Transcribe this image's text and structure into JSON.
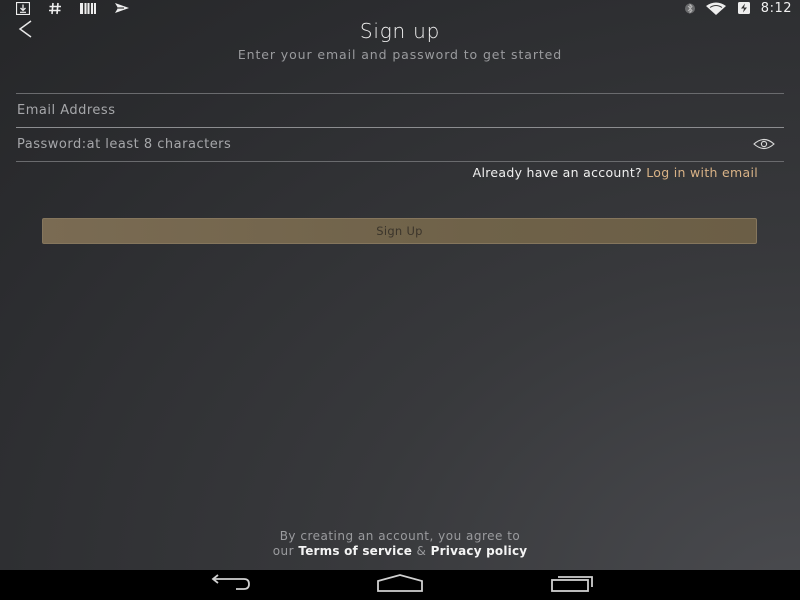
{
  "status_bar": {
    "time": "8:12",
    "left_icons": [
      "download-notification-icon",
      "hash-notification-icon",
      "barcode-notification-icon",
      "send-notification-icon"
    ],
    "right_icons": [
      "bluetooth-icon",
      "wifi-icon",
      "battery-charging-icon"
    ]
  },
  "header": {
    "back_icon": "chevron-left-icon",
    "title": "Sign up",
    "subtitle": "Enter your email and password to get started"
  },
  "form": {
    "email_placeholder": "Email Address",
    "email_value": "",
    "password_placeholder": "Password:at least 8 characters",
    "password_value": "",
    "toggle_visibility_icon": "eye-icon"
  },
  "login": {
    "prompt": "Already have an account?",
    "link": "Log in with email"
  },
  "signup_button": {
    "label": "Sign Up"
  },
  "legal": {
    "line1": "By creating an account, you agree to",
    "prefix": "our",
    "terms": "Terms of service",
    "amp": "&",
    "privacy": "Privacy policy"
  },
  "nav_bar": {
    "icons": [
      "back-nav-icon",
      "home-nav-icon",
      "recents-nav-icon"
    ]
  },
  "colors": {
    "accent_link": "#d8b286",
    "button_bg": "#72654c",
    "background": "#333437"
  }
}
